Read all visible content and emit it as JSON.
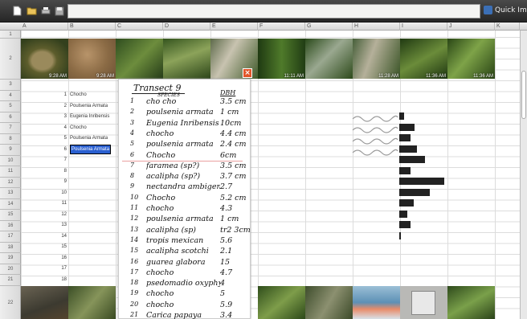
{
  "toolbar": {
    "quick_import_label": "Quick Import"
  },
  "columns": [
    "A",
    "B",
    "C",
    "D",
    "E",
    "F",
    "G",
    "H",
    "I",
    "J",
    "K"
  ],
  "rows": [
    "1",
    "2",
    "3",
    "4",
    "5",
    "6",
    "7",
    "8",
    "9",
    "10",
    "11",
    "12",
    "13",
    "14",
    "15",
    "16",
    "17",
    "18",
    "19",
    "20",
    "21",
    "22"
  ],
  "photo_timestamps": [
    "9:28 AM",
    "9:28 AM",
    "",
    "",
    "",
    "",
    "11:11 AM",
    "",
    "11:28 AM",
    "11:36 AM",
    "11:36 AM",
    ""
  ],
  "table": {
    "numbers": [
      "1",
      "2",
      "3",
      "4",
      "5",
      "6",
      "7",
      "8",
      "9",
      "10",
      "11",
      "12",
      "13",
      "14",
      "15",
      "16",
      "17",
      "18"
    ],
    "names": [
      "Chocho",
      "Poulsenia Armata",
      "Eugenia Inribensis",
      "Chocho",
      "Poulsenia Armata",
      "Poulsenia Armata"
    ]
  },
  "note": {
    "title": "Transect 9",
    "subtitle": "SPECIES",
    "dbh_header": "DBH",
    "lines": [
      {
        "num": "1",
        "species": "cho cho",
        "dbh": "3.5 cm"
      },
      {
        "num": "2",
        "species": "poulsenia armata",
        "dbh": "1 cm"
      },
      {
        "num": "3",
        "species": "Eugenia Inribensis",
        "dbh": "10cm"
      },
      {
        "num": "4",
        "species": "chocho",
        "dbh": "4.4 cm"
      },
      {
        "num": "5",
        "species": "poulsenia armata",
        "dbh": "2.4 cm"
      },
      {
        "num": "6",
        "species": "Chocho",
        "dbh": "6cm"
      },
      {
        "num": "7",
        "species": "faramea (sp?)",
        "dbh": "3.5 cm"
      },
      {
        "num": "8",
        "species": "acalipha (sp?)",
        "dbh": "3.7 cm"
      },
      {
        "num": "9",
        "species": "nectandra ambigens (sp?)",
        "dbh": "2.7"
      },
      {
        "num": "10",
        "species": "Chocho",
        "dbh": "5.2 cm"
      },
      {
        "num": "11",
        "species": "chocho",
        "dbh": "4.3"
      },
      {
        "num": "12",
        "species": "poulsenia armata",
        "dbh": "1 cm"
      },
      {
        "num": "13",
        "species": "acalipha (sp)",
        "dbh": "tr2 3cm"
      },
      {
        "num": "14",
        "species": "tropis mexican",
        "dbh": "5.6"
      },
      {
        "num": "15",
        "species": "acalipha scotchi",
        "dbh": "2.1"
      },
      {
        "num": "16",
        "species": "guarea glabora",
        "dbh": "15"
      },
      {
        "num": "17",
        "species": "chocho",
        "dbh": "4.7"
      },
      {
        "num": "18",
        "species": "psedomadio oxyphyllaria",
        "dbh": "4"
      },
      {
        "num": "19",
        "species": "chocho",
        "dbh": "5"
      },
      {
        "num": "20",
        "species": "chocho",
        "dbh": "5.9"
      },
      {
        "num": "21",
        "species": "Carica papaya",
        "dbh": "3.4"
      }
    ]
  },
  "bars": [
    {
      "value": 0.2
    },
    {
      "value": 0.6
    },
    {
      "value": 0.45
    },
    {
      "value": 0.7
    },
    {
      "value": 1.0
    },
    {
      "value": 0.45
    },
    {
      "value": 1.75
    },
    {
      "value": 1.2
    },
    {
      "value": 0.55
    },
    {
      "value": 0.3
    },
    {
      "value": 0.45
    },
    {
      "value": 0.05
    }
  ],
  "colors": {
    "accent": "#e2552a",
    "toolbar": "#333333",
    "selection": "#2a5fd0"
  }
}
